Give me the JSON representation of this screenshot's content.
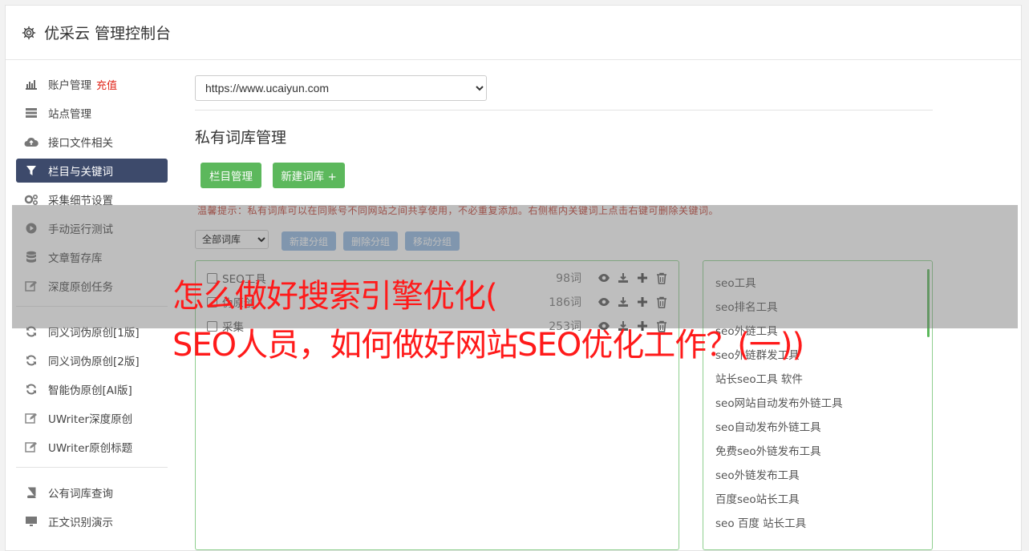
{
  "header": {
    "title": "优采云 管理控制台",
    "icon": "gear-icon"
  },
  "sidebar": {
    "items": [
      {
        "label": "账户管理",
        "badge": "充值",
        "icon": "bar-chart-icon"
      },
      {
        "label": "站点管理",
        "icon": "server-icon"
      },
      {
        "label": "接口文件相关",
        "icon": "cloud-upload-icon"
      },
      {
        "label": "栏目与关键词",
        "icon": "filter-icon",
        "active": true
      },
      {
        "label": "采集细节设置",
        "icon": "gears-icon"
      },
      {
        "label": "手动运行测试",
        "icon": "play-circle-icon"
      },
      {
        "label": "文章暂存库",
        "icon": "database-icon"
      },
      {
        "label": "深度原创任务",
        "icon": "edit-icon"
      },
      {
        "label": "同义词伪原创[1版]",
        "icon": "refresh-icon"
      },
      {
        "label": "同义词伪原创[2版]",
        "icon": "refresh-icon"
      },
      {
        "label": "智能伪原创[AI版]",
        "icon": "refresh-icon"
      },
      {
        "label": "UWriter深度原创",
        "icon": "edit-icon"
      },
      {
        "label": "UWriter原创标题",
        "icon": "edit-icon"
      },
      {
        "label": "公有词库查询",
        "icon": "book-icon"
      },
      {
        "label": "正文识别演示",
        "icon": "monitor-icon"
      }
    ]
  },
  "main": {
    "site_select": {
      "value": "https://www.ucaiyun.com"
    },
    "section_title": "私有词库管理",
    "buttons": {
      "column_manage": "栏目管理",
      "new_library": "新建词库 +"
    },
    "hint": "温馨提示：私有词库可以在同账号不同网站之间共享使用，不必重复添加。右侧框内关键词上点击右键可删除关键词。",
    "group_select": {
      "value": "全部词库"
    },
    "group_buttons": {
      "new_group": "新建分组",
      "delete_group": "删除分组",
      "move_group": "移动分组"
    },
    "libraries": [
      {
        "name": "SEO工具",
        "count": "98词"
      },
      {
        "name": "伪原创",
        "count": "186词"
      },
      {
        "name": "采集",
        "count": "253词"
      }
    ],
    "keywords": [
      "seo工具",
      "seo排名工具",
      "seo外链工具",
      "seo外链群发工具",
      "站长seo工具 软件",
      "seo网站自动发布外链工具",
      "seo自动发布外链工具",
      "免费seo外链发布工具",
      "seo外链发布工具",
      "百度seo站长工具",
      "seo 百度 站长工具"
    ]
  },
  "overlay": {
    "line1": "怎么做好搜索引擎优化(",
    "line2": "SEO人员，如何做好网站SEO优化工作？(一))"
  },
  "colors": {
    "green": "#5cb85c",
    "active_nav": "#3d4a6b",
    "overlay_text": "#ff1a1a",
    "light_blue_button": "#8eb7e2"
  }
}
